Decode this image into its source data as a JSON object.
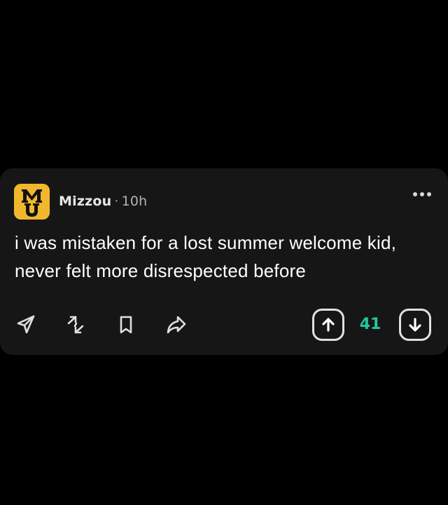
{
  "post": {
    "community": "Mizzou",
    "separator": "·",
    "time": "10h",
    "avatar_letters": "MU",
    "text": "i was mistaken for a lost summer welcome kid, never felt more disrespected before"
  },
  "actions": [
    {
      "name": "send",
      "icon": "send-icon"
    },
    {
      "name": "repost",
      "icon": "repost-arrows-icon"
    },
    {
      "name": "save",
      "icon": "bookmark-icon"
    },
    {
      "name": "share",
      "icon": "share-arrow-icon"
    }
  ],
  "vote": {
    "count": "41",
    "upvote_icon": "arrow-up-icon",
    "downvote_icon": "arrow-down-icon"
  },
  "colors": {
    "background": "#000000",
    "card": "#161616",
    "avatar": "#f1b82d",
    "vote_count": "#24c79b",
    "icon": "#e0e0e0"
  }
}
